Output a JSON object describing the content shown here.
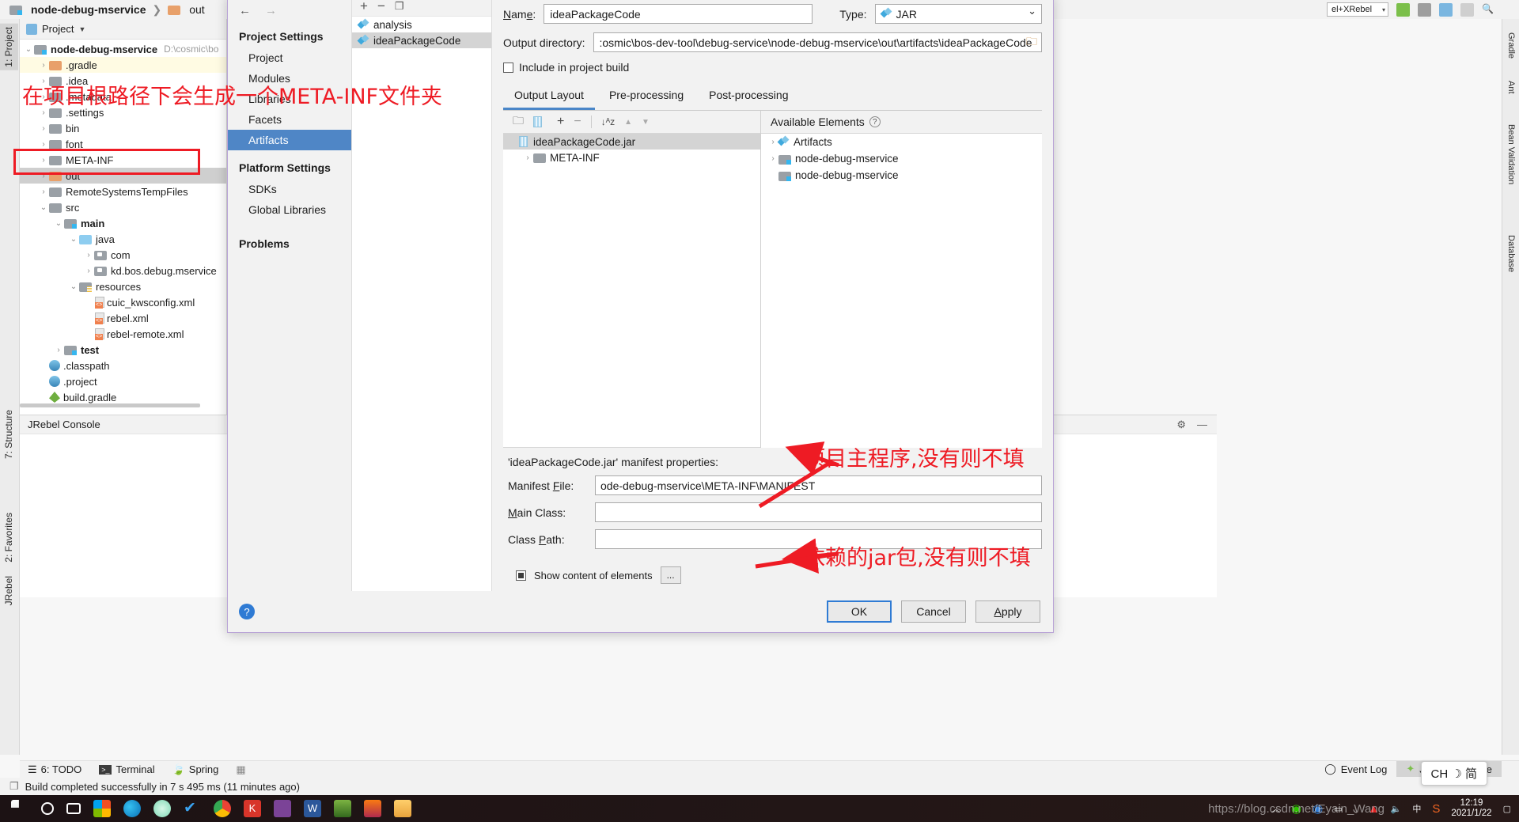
{
  "breadcrumb": {
    "project": "node-debug-mservice",
    "separator": "❯",
    "child": "out"
  },
  "topright": {
    "plugin_combo": "el+XRebel",
    "icons": [
      "jrebel-icon",
      "stop-icon",
      "layout-icon",
      "preview-icon",
      "search-icon"
    ]
  },
  "left_strips": [
    {
      "label": "1: Project",
      "selected": true
    },
    {
      "label": "7: Structure",
      "selected": false
    },
    {
      "label": "2: Favorites",
      "selected": false
    },
    {
      "label": "JRebel",
      "selected": false
    }
  ],
  "right_strips": [
    "Gradle",
    "Ant",
    "Bean Validation",
    "Database"
  ],
  "project_panel": {
    "title": "Project",
    "tree": [
      {
        "indent": 0,
        "arrow": "v",
        "icon": "module-folder-icon",
        "label": "node-debug-mservice",
        "bold": true,
        "path": "D:\\cosmic\\bo",
        "state": "normal"
      },
      {
        "indent": 1,
        "arrow": ">",
        "icon": "folder-orange-icon",
        "label": ".gradle",
        "bold": false,
        "state": "highlight"
      },
      {
        "indent": 1,
        "arrow": ">",
        "icon": "folder-icon",
        "label": ".idea",
        "bold": false,
        "state": "normal"
      },
      {
        "indent": 1,
        "arrow": ">",
        "icon": "folder-icon",
        "label": ".metadata",
        "bold": false,
        "state": "normal"
      },
      {
        "indent": 1,
        "arrow": ">",
        "icon": "folder-icon",
        "label": ".settings",
        "bold": false,
        "state": "normal"
      },
      {
        "indent": 1,
        "arrow": ">",
        "icon": "folder-icon",
        "label": "bin",
        "bold": false,
        "state": "normal"
      },
      {
        "indent": 1,
        "arrow": ">",
        "icon": "folder-icon",
        "label": "font",
        "bold": false,
        "state": "normal"
      },
      {
        "indent": 1,
        "arrow": ">",
        "icon": "folder-icon",
        "label": "META-INF",
        "bold": false,
        "state": "normal"
      },
      {
        "indent": 1,
        "arrow": ">",
        "icon": "folder-orange-icon",
        "label": "out",
        "bold": false,
        "state": "selected"
      },
      {
        "indent": 1,
        "arrow": ">",
        "icon": "folder-icon",
        "label": "RemoteSystemsTempFiles",
        "bold": false,
        "state": "normal"
      },
      {
        "indent": 1,
        "arrow": "v",
        "icon": "folder-icon",
        "label": "src",
        "bold": false,
        "state": "normal"
      },
      {
        "indent": 2,
        "arrow": "v",
        "icon": "module-folder-icon",
        "label": "main",
        "bold": true,
        "state": "normal"
      },
      {
        "indent": 3,
        "arrow": "v",
        "icon": "folder-blue-icon",
        "label": "java",
        "bold": false,
        "state": "normal"
      },
      {
        "indent": 4,
        "arrow": ">",
        "icon": "package-icon",
        "label": "com",
        "bold": false,
        "state": "normal"
      },
      {
        "indent": 4,
        "arrow": ">",
        "icon": "package-icon",
        "label": "kd.bos.debug.mservice",
        "bold": false,
        "state": "normal"
      },
      {
        "indent": 3,
        "arrow": "v",
        "icon": "resources-folder-icon",
        "label": "resources",
        "bold": false,
        "state": "normal"
      },
      {
        "indent": 4,
        "arrow": "",
        "icon": "xml-file-icon",
        "label": "cuic_kwsconfig.xml",
        "bold": false,
        "state": "normal"
      },
      {
        "indent": 4,
        "arrow": "",
        "icon": "xml-file-icon",
        "label": "rebel.xml",
        "bold": false,
        "state": "normal"
      },
      {
        "indent": 4,
        "arrow": "",
        "icon": "xml-file-icon",
        "label": "rebel-remote.xml",
        "bold": false,
        "state": "normal"
      },
      {
        "indent": 2,
        "arrow": ">",
        "icon": "module-folder-icon",
        "label": "test",
        "bold": true,
        "state": "normal"
      },
      {
        "indent": 1,
        "arrow": "",
        "icon": "file-blue-icon",
        "label": ".classpath",
        "bold": false,
        "state": "normal"
      },
      {
        "indent": 1,
        "arrow": "",
        "icon": "file-blue-icon",
        "label": ".project",
        "bold": false,
        "state": "normal"
      },
      {
        "indent": 1,
        "arrow": "",
        "icon": "gradle-file-icon",
        "label": "build.gradle",
        "bold": false,
        "state": "scrollbar"
      }
    ]
  },
  "console_panel": {
    "title": "JRebel Console"
  },
  "bottom_tool_buttons": [
    {
      "label": "6: TODO",
      "icon": "todo-icon"
    },
    {
      "label": "Terminal",
      "icon": "terminal-icon"
    },
    {
      "label": "Spring",
      "icon": "spring-leaf-icon"
    }
  ],
  "bottom_right_tools": [
    {
      "label": "Event Log",
      "icon": "event-log-icon",
      "active": false
    },
    {
      "label": "JRebel Console",
      "icon": "jrebel-icon",
      "active": true
    }
  ],
  "status_bar": {
    "message": "Build completed successfully in 7 s 495 ms (11 minutes ago)"
  },
  "dialog": {
    "nav": {
      "back_icon": "arrow-left-icon",
      "forward_icon": "arrow-right-icon",
      "sections": [
        {
          "title": "Project Settings",
          "items": [
            {
              "label": "Project",
              "selected": false
            },
            {
              "label": "Modules",
              "selected": false
            },
            {
              "label": "Libraries",
              "selected": false
            },
            {
              "label": "Facets",
              "selected": false
            },
            {
              "label": "Artifacts",
              "selected": true
            }
          ]
        },
        {
          "title": "Platform Settings",
          "items": [
            {
              "label": "SDKs",
              "selected": false
            },
            {
              "label": "Global Libraries",
              "selected": false
            }
          ]
        },
        {
          "title": "Problems",
          "items": []
        }
      ]
    },
    "artifact_list": {
      "tools": [
        "add-icon",
        "remove-icon",
        "copy-icon"
      ],
      "items": [
        {
          "label": "analysis",
          "selected": false
        },
        {
          "label": "ideaPackageCode",
          "selected": true
        }
      ]
    },
    "name_label": "Name:",
    "name_value": "ideaPackageCode",
    "type_label": "Type:",
    "type_value": "JAR",
    "output_dir_label": "Output directory:",
    "output_dir_value": ":osmic\\bos-dev-tool\\debug-service\\node-debug-mservice\\out\\artifacts\\ideaPackageCode",
    "output_dir_browse_icon": "folder-browse-icon",
    "include_in_build_label": "Include in project build",
    "include_in_build_checked": false,
    "tabs": [
      {
        "label": "Output Layout",
        "selected": true
      },
      {
        "label": "Pre-processing",
        "selected": false
      },
      {
        "label": "Post-processing",
        "selected": false
      }
    ],
    "layout_tools": [
      "create-directory-icon",
      "create-archive-icon",
      "add-copy-icon",
      "remove-icon",
      "sort-az-icon",
      "move-up-icon",
      "move-down-icon"
    ],
    "layout_tree": [
      {
        "indent": 0,
        "arrow": "",
        "icon": "jar-icon",
        "label": "ideaPackageCode.jar",
        "selected": true
      },
      {
        "indent": 1,
        "arrow": ">",
        "icon": "folder-icon",
        "label": "META-INF",
        "selected": false
      }
    ],
    "available_elements_label": "Available Elements",
    "available_elements_help_icon": "help-icon",
    "available_tree": [
      {
        "indent": 0,
        "arrow": ">",
        "icon": "artifact-icon",
        "label": "Artifacts"
      },
      {
        "indent": 0,
        "arrow": ">",
        "icon": "module-folder-icon",
        "label": "node-debug-mservice"
      },
      {
        "indent": 0,
        "arrow": "",
        "icon": "module-folder-icon",
        "label": "node-debug-mservice"
      }
    ],
    "manifest_title": "'ideaPackageCode.jar' manifest properties:",
    "manifest_file_label": "Manifest File:",
    "manifest_file_value": "ode-debug-mservice\\META-INF\\MANIFEST",
    "main_class_label": "Main Class:",
    "main_class_value": "",
    "class_path_label": "Class Path:",
    "class_path_value": "",
    "show_content_label": "Show content of elements",
    "show_content_checked": true,
    "ellipsis_label": "...",
    "help_button_icon": "help-icon",
    "buttons": [
      {
        "label": "OK",
        "default": true
      },
      {
        "label": "Cancel",
        "default": false
      },
      {
        "label": "Apply",
        "default": false
      }
    ]
  },
  "annotations": [
    {
      "id": "meta-inf-note",
      "text": "在项目根路径下会生成一个META-INF文件夹"
    },
    {
      "id": "main-class-note",
      "text": "项目主程序,没有则不填"
    },
    {
      "id": "class-path-note",
      "text": "依赖的jar包,没有则不填"
    }
  ],
  "ime_indicator": "CH ☽ 简",
  "taskbar": {
    "watermark": "https://blog.csdn.net/Eyain_Wang",
    "clock_time": "12:19",
    "clock_date": "2021/1/22",
    "icons": [
      "start-icon",
      "search-icon",
      "task-view-icon",
      "office-icon",
      "edge-icon",
      "app-icon",
      "todo-icon",
      "chrome-icon",
      "kingsoft-icon",
      "onenote-icon",
      "word-icon",
      "game-icon",
      "idea-icon",
      "explorer-icon"
    ],
    "tray_icons": [
      "chevron-up-icon",
      "wechat-icon",
      "screenshot-icon",
      "battery-icon",
      "wifi-icon",
      "antivirus-icon",
      "volume-icon",
      "ime-icon",
      "sogou-icon"
    ]
  },
  "colors": {
    "accent": "#4f86c6",
    "annotation_red": "#ee1b24",
    "selection_gray": "#d4d4d4",
    "dialog_border": "#b9a3d6"
  }
}
